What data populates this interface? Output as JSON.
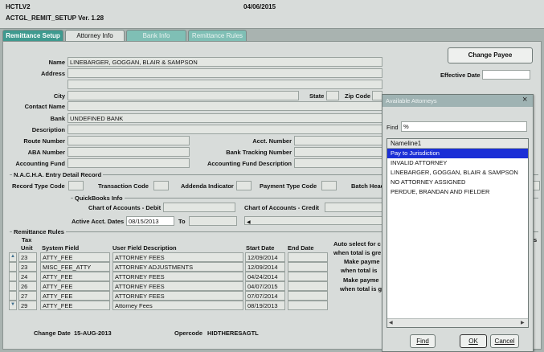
{
  "app": {
    "code": "HCTLV2",
    "date": "04/06/2015",
    "form": "ACTGL_REMIT_SETUP Ver. 1.28"
  },
  "tabs": [
    "Remittance Setup",
    "Attorney Info",
    "Bank Info",
    "Remittance Rules"
  ],
  "buttons": {
    "change_payee": "Change Payee"
  },
  "labels": {
    "name": "Name",
    "address": "Address",
    "city": "City",
    "state": "State",
    "zip": "Zip Code",
    "contact_name": "Contact Name",
    "bank": "Bank",
    "description": "Description",
    "route_number": "Route Number",
    "acct_number": "Acct. Number",
    "aba_number": "ABA Number",
    "bank_tracking": "Bank Tracking Number",
    "accounting_fund": "Accounting Fund",
    "accounting_fund_desc": "Accounting Fund Description",
    "effective_date": "Effective Date"
  },
  "values": {
    "name": "LINEBARGER, GOGGAN, BLAIR & SAMPSON",
    "bank": "UNDEFINED BANK"
  },
  "nacha": {
    "title": "N.A.C.H.A. Entry Detail Record",
    "record_type": "Record Type Code",
    "transaction": "Transaction Code",
    "addenda": "Addenda Indicator",
    "payment_type": "Payment Type Code",
    "batch": "Batch Head"
  },
  "qb": {
    "title": "QuickBooks Info",
    "debit": "Chart of Accounts - Debit",
    "credit": "Chart of Accounts - Credit",
    "active": "Active Acct. Dates",
    "active_from": "08/15/2013",
    "to": "To"
  },
  "rules": {
    "title": "Remittance Rules",
    "headers": {
      "tax": "Tax",
      "unit": "Unit",
      "system_field": "System Field",
      "user_field": "User Field Description",
      "start": "Start Date",
      "end": "End Date"
    },
    "rows": [
      {
        "unit": "23",
        "system": "ATTY_FEE",
        "user": "ATTORNEY FEES",
        "start": "12/09/2014",
        "end": ""
      },
      {
        "unit": "23",
        "system": "MISC_FEE_ATTY",
        "user": "ATTORNEY ADJUSTMENTS",
        "start": "12/09/2014",
        "end": ""
      },
      {
        "unit": "24",
        "system": "ATTY_FEE",
        "user": "ATTORNEY FEES",
        "start": "04/24/2014",
        "end": ""
      },
      {
        "unit": "26",
        "system": "ATTY_FEE",
        "user": "ATTORNEY FEES",
        "start": "04/07/2015",
        "end": ""
      },
      {
        "unit": "27",
        "system": "ATTY_FEE",
        "user": "ATTORNEY FEES",
        "start": "07/07/2014",
        "end": ""
      },
      {
        "unit": "29",
        "system": "ATTY_FEE",
        "user": "Attorney Fees",
        "start": "08/19/2013",
        "end": ""
      }
    ],
    "side": [
      "Auto select for c",
      "when total is gre",
      "Make payme",
      "when total is",
      "Make payme",
      "when total is g"
    ],
    "side_right": "s"
  },
  "footer": {
    "change_date_label": "Change Date",
    "change_date": "15-AUG-2013",
    "opercode_label": "Opercode",
    "opercode": "HIDTHERESAGTL"
  },
  "dialog": {
    "title": "Available Attorneys",
    "find_label": "Find",
    "find_value": "%",
    "column": "Nameline1",
    "items": [
      "Pay to Jurisdiction",
      "INVALID ATTORNEY",
      "LINEBARGER, GOGGAN, BLAIR & SAMPSON",
      "NO ATTORNEY ASSIGNED",
      "PERDUE, BRANDAN AND FIELDER"
    ],
    "selected": 0,
    "buttons": {
      "find": "Find",
      "ok": "OK",
      "cancel": "Cancel"
    }
  },
  "colors": {
    "selection": "#1b2fd6",
    "dialog_title": "#9fb3b3",
    "tab_active": "#3f9a8f"
  }
}
